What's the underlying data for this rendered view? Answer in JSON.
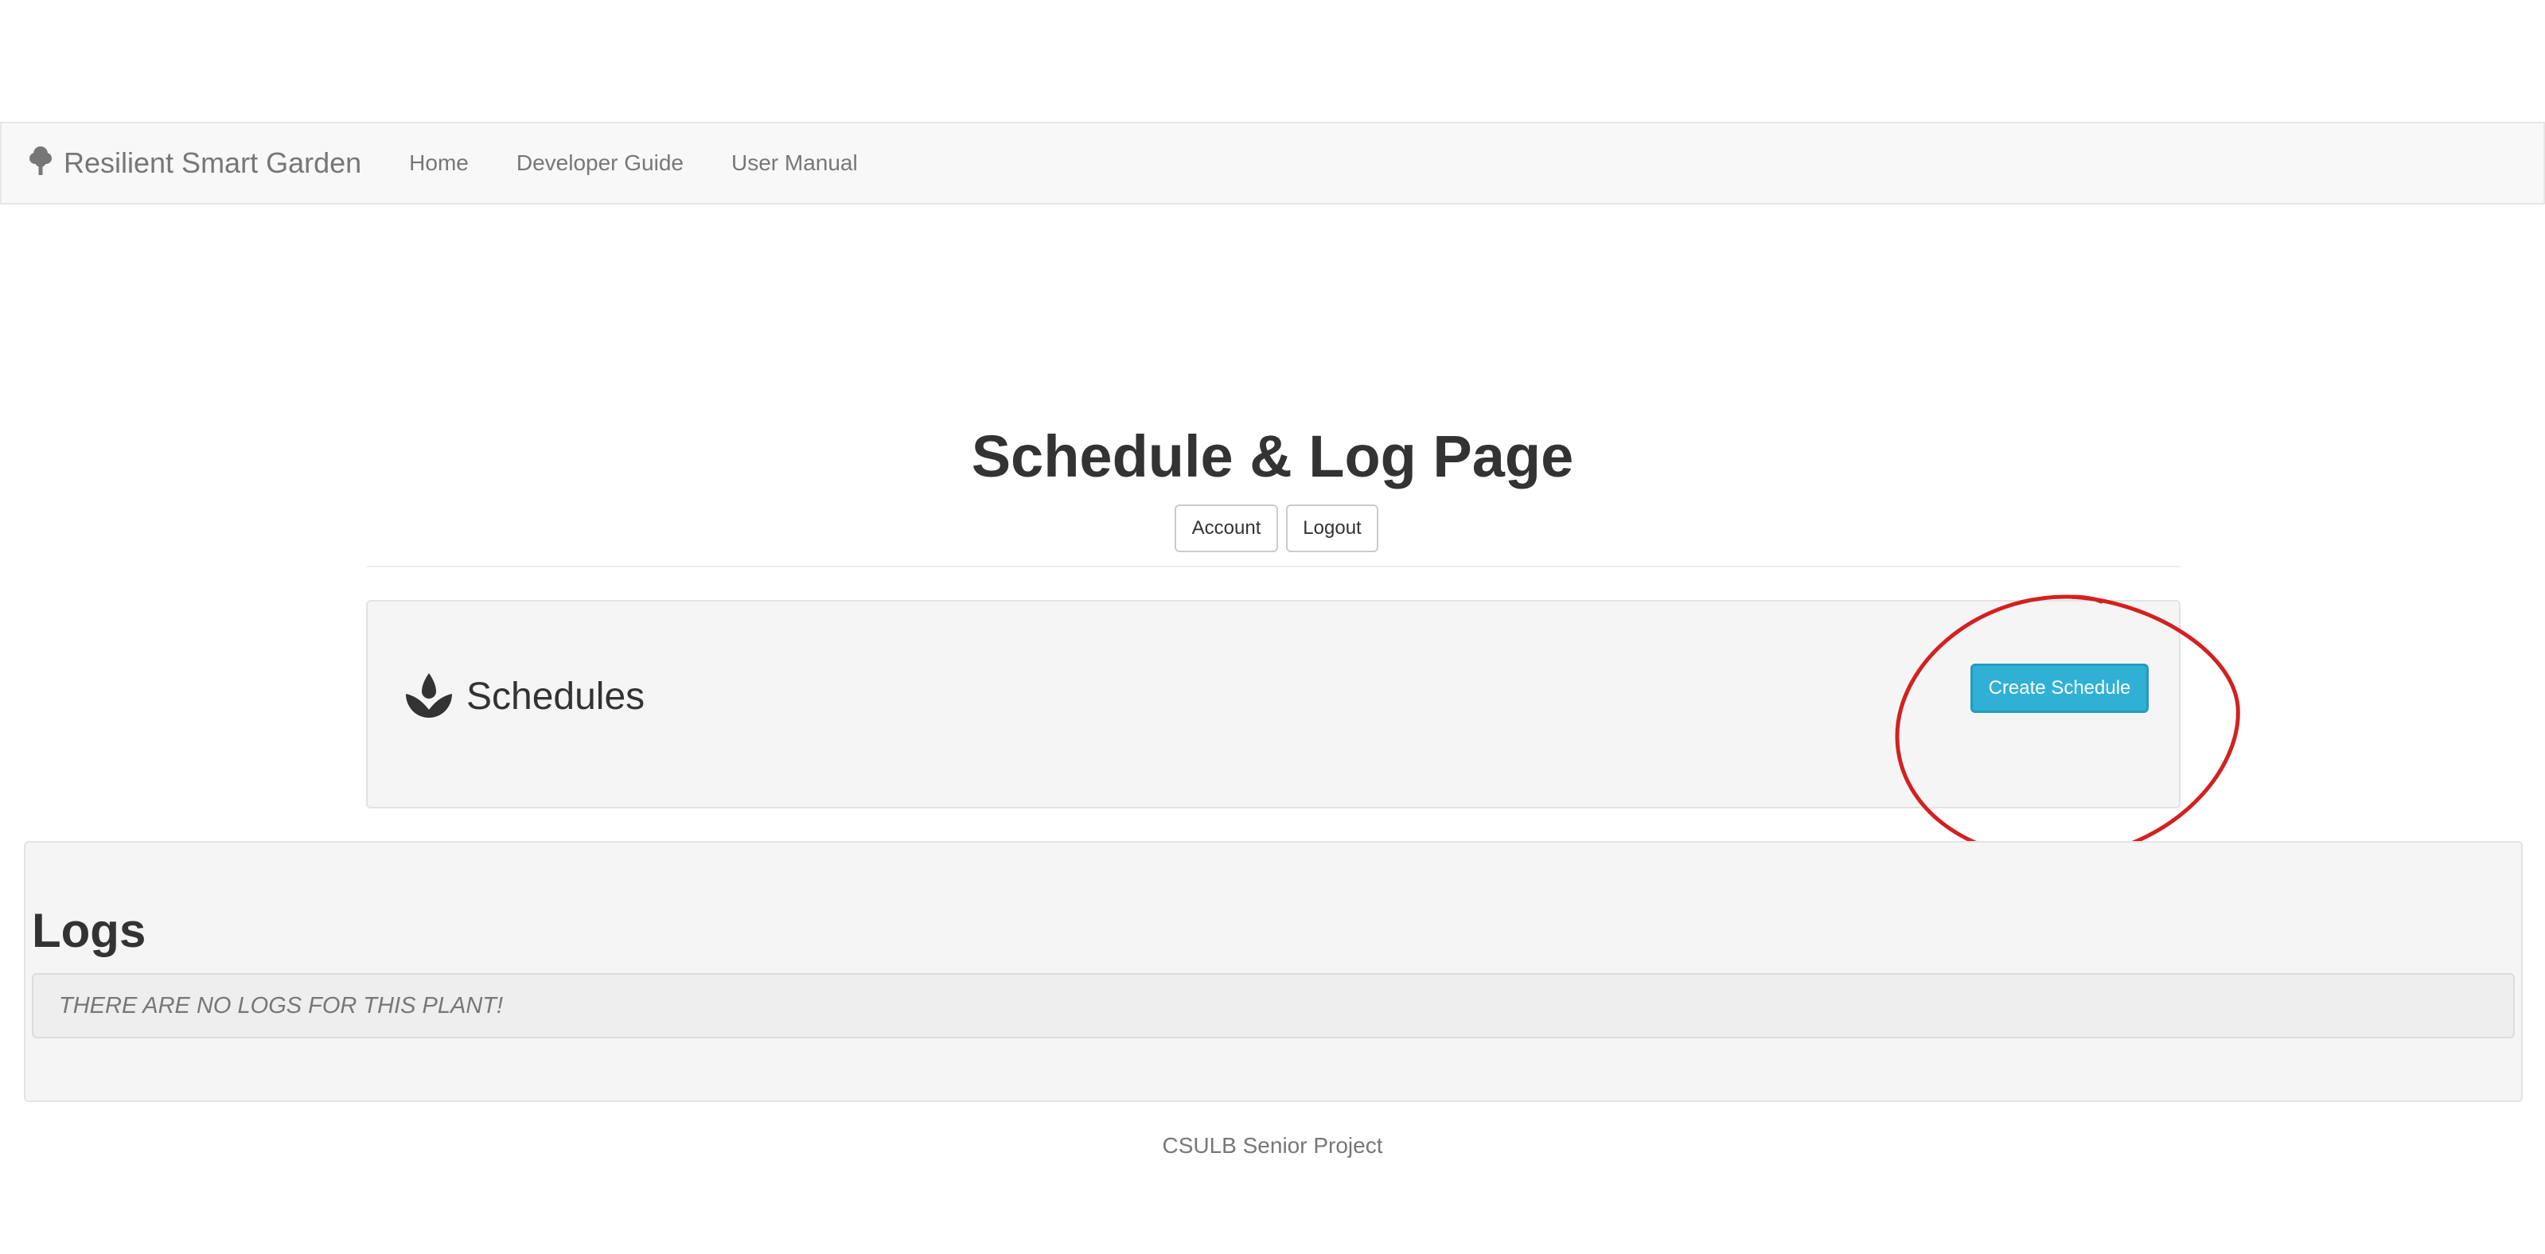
{
  "navbar": {
    "brand": "Resilient Smart Garden",
    "brand_icon": "tree-icon",
    "links": [
      "Home",
      "Developer Guide",
      "User Manual"
    ]
  },
  "header": {
    "title": "Schedule & Log Page",
    "account_label": "Account",
    "logout_label": "Logout"
  },
  "schedules": {
    "icon": "spa-icon",
    "title": "Schedules",
    "create_label": "Create Schedule"
  },
  "logs": {
    "title": "Logs",
    "empty_message": "THERE ARE NO LOGS FOR THIS PLANT!"
  },
  "footer": {
    "text": "CSULB Senior Project"
  },
  "colors": {
    "navbar_bg": "#f8f8f8",
    "info_button": "#31b0d5",
    "panel_bg": "#f5f5f5",
    "annotation": "#d42020"
  }
}
